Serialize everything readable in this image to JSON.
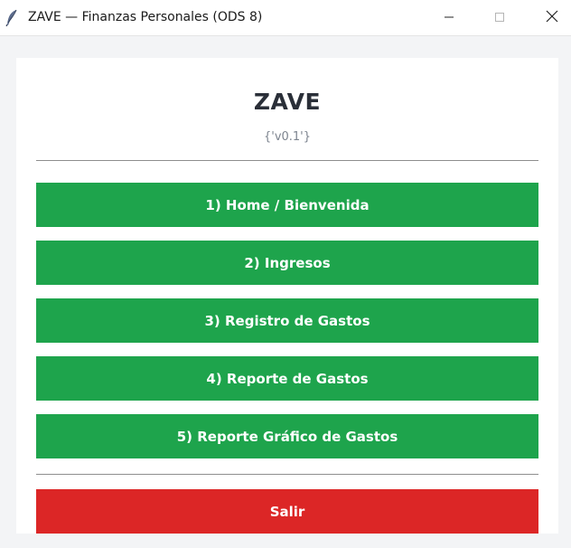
{
  "window": {
    "title": "ZAVE — Finanzas Personales (ODS 8)",
    "controls": {
      "minimize_icon": "minimize-icon",
      "maximize_icon": "maximize-icon",
      "close_icon": "close-icon"
    }
  },
  "header": {
    "app_title": "ZAVE",
    "version": "{'v0.1'}"
  },
  "menu": {
    "items": [
      {
        "label": "1) Home / Bienvenida"
      },
      {
        "label": "2) Ingresos"
      },
      {
        "label": "3) Registro de Gastos"
      },
      {
        "label": "4) Reporte de Gastos"
      },
      {
        "label": "5) Reporte Gráfico de Gastos"
      }
    ],
    "exit_label": "Salir"
  },
  "colors": {
    "menu_button": "#1ea44c",
    "exit_button": "#dc2626",
    "title_text": "#2a2f38",
    "version_text": "#7d848f"
  }
}
